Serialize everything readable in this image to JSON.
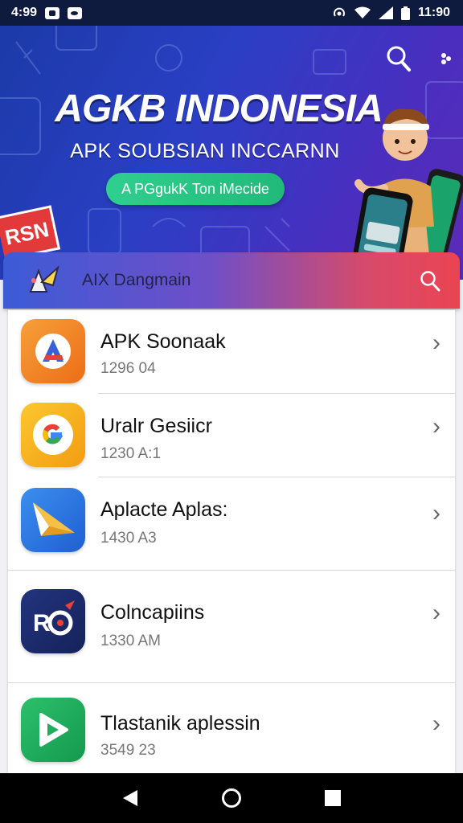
{
  "status_bar": {
    "time_left": "4:99",
    "time_right": "11:90"
  },
  "hero": {
    "title": "AGKB INDONESIA",
    "subtitle": "APK SOUBSIAN INCCARNN",
    "cta_label": "A PGgukK Ton iMecide",
    "badge": "RSN"
  },
  "section": {
    "title": "AIX Dangmain"
  },
  "apps": [
    {
      "name": "APK Soonaak",
      "meta": "1296 04",
      "icon": "a-logo-icon",
      "color": "#f28a1e"
    },
    {
      "name": "Uralr Gesiicr",
      "meta": "1230 A:1",
      "icon": "google-g-icon",
      "color": "#f7b21c"
    },
    {
      "name": "Aplacte Aplas:",
      "meta": "1430 A3",
      "icon": "paper-plane-icon",
      "color": "#2f7de1"
    },
    {
      "name": "Colncapiins",
      "meta": "1330 AM",
      "icon": "rg-logo-icon",
      "color": "#1c2a6e"
    },
    {
      "name": "Tlastanik aplessin",
      "meta": "3549 23",
      "icon": "play-icon",
      "color": "#1fae5e"
    }
  ],
  "chevron": "›",
  "nav": [
    "back-icon",
    "home-icon",
    "recents-icon"
  ]
}
